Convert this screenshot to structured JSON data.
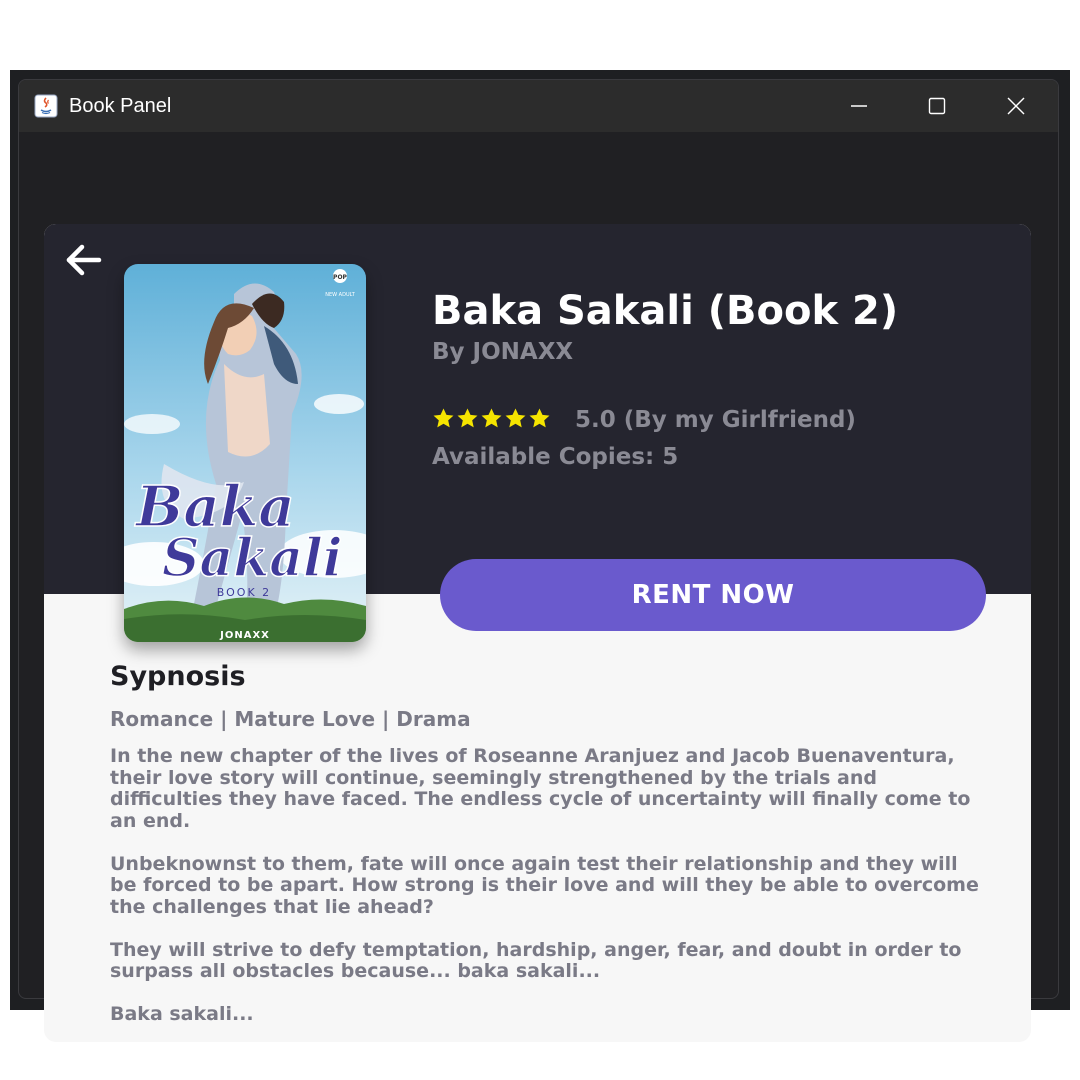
{
  "window": {
    "title": "Book Panel",
    "controls": {
      "minimize": "minimize-icon",
      "maximize": "maximize-icon",
      "close": "close-icon"
    }
  },
  "book": {
    "title": "Baka Sakali (Book 2)",
    "author": "By JONAXX",
    "rating": 5,
    "rating_max": 5,
    "rating_text": "5.0 (By my Girlfriend)",
    "available_copies": "Available Copies: 5",
    "rent_button": "RENT NOW",
    "cover": {
      "title_line1": "Baka",
      "title_line2": "Sakali",
      "subtitle": "BOOK 2",
      "author": "JONAXX",
      "publisher": "POP",
      "tag": "NEW ADULT"
    }
  },
  "synopsis": {
    "heading": "Sypnosis",
    "genres": "Romance | Mature Love | Drama",
    "paragraphs": [
      "In the new chapter of the lives of Roseanne Aranjuez and Jacob Buenaventura, their love story will continue, seemingly strengthened by the trials and difficulties they have faced. The endless cycle of uncertainty will finally come to an end.",
      "Unbeknownst to them, fate will once again test their relationship and they will be forced to be apart. How strong is their love and will they be able to overcome the challenges that lie ahead?",
      "They will strive to defy temptation, hardship, anger, fear, and doubt in order to surpass all obstacles because... baka sakali...",
      "Baka sakali..."
    ]
  },
  "colors": {
    "header_dark": "#25252f",
    "accent": "#6a5acd",
    "star": "#f5e400",
    "muted_text": "#8a8a94"
  }
}
